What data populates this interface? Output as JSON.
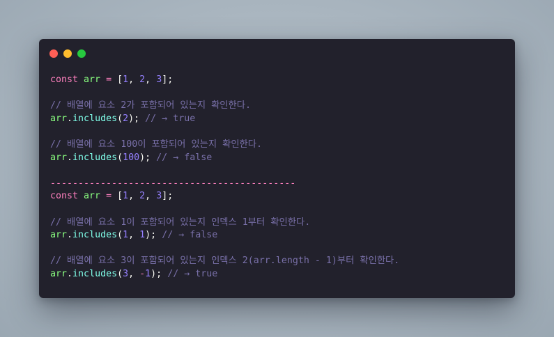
{
  "colors": {
    "background": "#a9b5bf",
    "window": "#22212c",
    "close": "#ff5f56",
    "minimize": "#ffbd2e",
    "maximize": "#27c93f",
    "keyword": "#ff80bf",
    "variable": "#8aff80",
    "method": "#80ffea",
    "number": "#9580ff",
    "punctuation": "#f8f8f2",
    "comment": "#7970a9",
    "divider": "#ff80bf"
  },
  "window_controls": [
    "close-dot",
    "minimize-dot",
    "maximize-dot"
  ],
  "lines": [
    [
      [
        "keyword",
        "const"
      ],
      [
        "plain",
        " "
      ],
      [
        "variable",
        "arr"
      ],
      [
        "plain",
        " "
      ],
      [
        "keyword",
        "="
      ],
      [
        "plain",
        " ["
      ],
      [
        "number",
        "1"
      ],
      [
        "plain",
        ", "
      ],
      [
        "number",
        "2"
      ],
      [
        "plain",
        ", "
      ],
      [
        "number",
        "3"
      ],
      [
        "plain",
        "];"
      ]
    ],
    [],
    [
      [
        "comment",
        "// 배열에 요소 2가 포함되어 있는지 확인한다."
      ]
    ],
    [
      [
        "variable",
        "arr"
      ],
      [
        "plain",
        "."
      ],
      [
        "method",
        "includes"
      ],
      [
        "plain",
        "("
      ],
      [
        "number",
        "2"
      ],
      [
        "plain",
        "); "
      ],
      [
        "comment",
        "// → true"
      ]
    ],
    [],
    [
      [
        "comment",
        "// 배열에 요소 100이 포함되어 있는지 확인한다."
      ]
    ],
    [
      [
        "variable",
        "arr"
      ],
      [
        "plain",
        "."
      ],
      [
        "method",
        "includes"
      ],
      [
        "plain",
        "("
      ],
      [
        "number",
        "100"
      ],
      [
        "plain",
        "); "
      ],
      [
        "comment",
        "// → false"
      ]
    ],
    [],
    [
      [
        "divider",
        "--------------------------------------------"
      ]
    ],
    [
      [
        "keyword",
        "const"
      ],
      [
        "plain",
        " "
      ],
      [
        "variable",
        "arr"
      ],
      [
        "plain",
        " "
      ],
      [
        "keyword",
        "="
      ],
      [
        "plain",
        " ["
      ],
      [
        "number",
        "1"
      ],
      [
        "plain",
        ", "
      ],
      [
        "number",
        "2"
      ],
      [
        "plain",
        ", "
      ],
      [
        "number",
        "3"
      ],
      [
        "plain",
        "];"
      ]
    ],
    [],
    [
      [
        "comment",
        "// 배열에 요소 1이 포함되어 있는지 인덱스 1부터 확인한다."
      ]
    ],
    [
      [
        "variable",
        "arr"
      ],
      [
        "plain",
        "."
      ],
      [
        "method",
        "includes"
      ],
      [
        "plain",
        "("
      ],
      [
        "number",
        "1"
      ],
      [
        "plain",
        ", "
      ],
      [
        "number",
        "1"
      ],
      [
        "plain",
        "); "
      ],
      [
        "comment",
        "// → false"
      ]
    ],
    [],
    [
      [
        "comment",
        "// 배열에 요소 3이 포함되어 있는지 인덱스 2(arr.length - 1)부터 확인한다."
      ]
    ],
    [
      [
        "variable",
        "arr"
      ],
      [
        "plain",
        "."
      ],
      [
        "method",
        "includes"
      ],
      [
        "plain",
        "("
      ],
      [
        "number",
        "3"
      ],
      [
        "plain",
        ", "
      ],
      [
        "keyword",
        "-"
      ],
      [
        "number",
        "1"
      ],
      [
        "plain",
        "); "
      ],
      [
        "comment",
        "// → true"
      ]
    ]
  ]
}
